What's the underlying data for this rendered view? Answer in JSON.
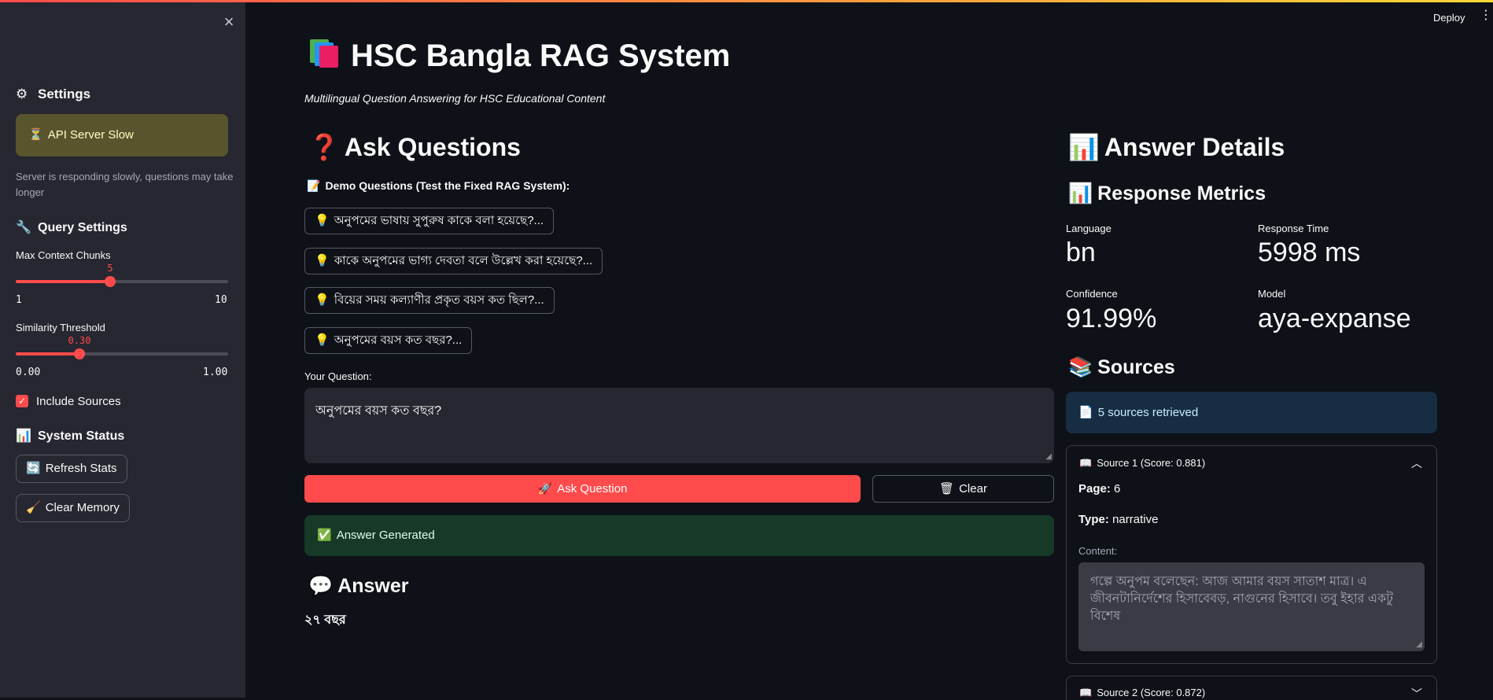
{
  "sidebar": {
    "close_glyph": "×",
    "settings_title": "Settings",
    "status_alert": "API Server Slow",
    "status_note": "Server is responding slowly, questions may take longer",
    "query_settings_title": "Query Settings",
    "max_chunks": {
      "label": "Max Context Chunks",
      "value": "5",
      "value_num": 5,
      "min": "1",
      "max": "10"
    },
    "similarity": {
      "label": "Similarity Threshold",
      "value": "0.30",
      "value_num": 0.3,
      "min": "0.00",
      "max": "1.00"
    },
    "include_sources_label": "Include Sources",
    "include_sources_checked": true,
    "system_status_title": "System Status",
    "refresh_label": "Refresh Stats",
    "clear_memory_label": "Clear Memory"
  },
  "header": {
    "deploy_label": "Deploy",
    "menu_glyph": "⋮"
  },
  "main": {
    "title": "HSC Bangla RAG System",
    "subtitle": "Multilingual Question Answering for HSC Educational Content",
    "ask_title": "Ask Questions",
    "demo_title": "Demo Questions (Test the Fixed RAG System):",
    "demo_questions": [
      "অনুপমের ভাষায় সুপুরুষ কাকে বলা হয়েছে?...",
      "কাকে অনুপমের ভাগ্য দেবতা বলে উল্লেখ করা হয়েছে?...",
      "বিয়ের সময় কল্যাণীর প্রকৃত বয়স কত ছিল?...",
      "অনুপমের বয়স কত বছর?..."
    ],
    "question_label": "Your Question:",
    "question_value": "অনুপমের বয়স কত বছর?",
    "ask_button": "Ask Question",
    "clear_button": "Clear",
    "success_message": "Answer Generated",
    "answer_title": "Answer",
    "answer_text": "২৭ বছর"
  },
  "details": {
    "title": "Answer Details",
    "metrics_title": "Response Metrics",
    "metrics": {
      "language_label": "Language",
      "language_value": "bn",
      "response_time_label": "Response Time",
      "response_time_value": "5998 ms",
      "confidence_label": "Confidence",
      "confidence_value": "91.99%",
      "model_label": "Model",
      "model_value": "aya-expanse"
    },
    "sources_title": "Sources",
    "sources_info": "5 sources retrieved",
    "source1": {
      "header": "Source 1 (Score: 0.881)",
      "page_label": "Page:",
      "page_value": "6",
      "type_label": "Type:",
      "type_value": "narrative",
      "content_label": "Content:",
      "content": "গল্পে অনুপম বলেছেন: আজ আমার বয়স সাতাশ মাত্র। এ জীবনটানির্দেশের হিসাবেবড়, নাগুনের হিসাবে। তবু ইহার একটু বিশেষ"
    },
    "source2": {
      "header": "Source 2 (Score: 0.872)"
    }
  },
  "colors": {
    "accent": "#ff4b4b",
    "background": "#0e1117",
    "sidebar": "#262730",
    "warning_bg": "#58542e",
    "success_bg": "#173928",
    "info_bg": "#172d43"
  },
  "icons": {
    "settings": "gear-icon",
    "hourglass": "hourglass-icon",
    "wrench": "wrench-icon",
    "bar_chart": "bar-chart-icon",
    "refresh": "refresh-icon",
    "broom": "broom-icon",
    "books": "books-icon",
    "question": "question-mark-icon",
    "memo": "memo-icon",
    "bulb": "lightbulb-icon",
    "rocket": "rocket-icon",
    "trash": "wastebasket-icon",
    "check": "checkmark-icon",
    "speech": "speech-balloon-icon",
    "page": "page-icon",
    "open_book": "open-book-icon"
  }
}
